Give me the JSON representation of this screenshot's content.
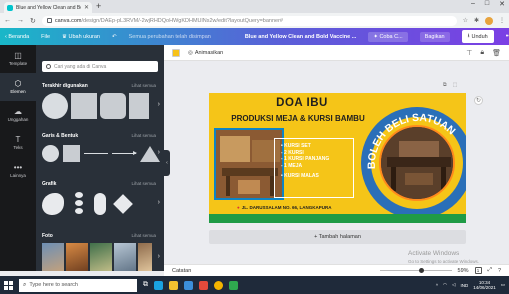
{
  "browser": {
    "tab_title": "Blue and Yellow Clean and Bo...",
    "url_host": "canva.com",
    "url_path": "/design/DAEp-pL3RVM/-2wjRHDQoHWgKDHMUlNs2w/edit?layoutQuery=banner#",
    "window_controls": [
      "–",
      "□",
      "✕"
    ]
  },
  "topbar": {
    "home": "‹ Beranda",
    "file": "File",
    "resize": "♛ Ubah ukuran",
    "undo": "↶",
    "saved_status": "Semua perubahan telah disimpan",
    "design_title": "Blue and Yellow Clean and Bold Vaccine ...",
    "try_pro": "✦ Coba C...",
    "share": "Bagikan",
    "download": "Unduh",
    "more": "•••"
  },
  "rail": [
    {
      "label": "Template",
      "icon": "◫"
    },
    {
      "label": "Elemen",
      "icon": "⬡"
    },
    {
      "label": "Unggahan",
      "icon": "☁"
    },
    {
      "label": "Teks",
      "icon": "T"
    },
    {
      "label": "Lainnya",
      "icon": "•••"
    }
  ],
  "panel": {
    "search_placeholder": "Cari yang ada di Canva",
    "sections": [
      {
        "title": "Terakhir digunakan",
        "more": "Lihat semua"
      },
      {
        "title": "Garis & Bentuk",
        "more": "Lihat semua"
      },
      {
        "title": "Grafik",
        "more": "Lihat semua"
      },
      {
        "title": "Foto",
        "more": "Lihat semua"
      }
    ]
  },
  "toolbar": {
    "animate": "Animasikan",
    "accent_color": "#f7c21a"
  },
  "design": {
    "title": "DOA IBU",
    "subtitle": "PRODUKSI MEJA & KURSI BAMBU",
    "items": [
      "• KURSI SET",
      "- 2 KURSI",
      "- 1 KURSI PANJANG",
      "- 1 MEJA"
    ],
    "extra_item": "• KURSI MALAS",
    "circle_text": "BOLEH BELI SATUAN",
    "address": "JL. DARUSSALAM NO. 66, LANGKAPURA",
    "bg_color": "#f5c518",
    "accent_blue": "#2a6fb8",
    "accent_green": "#1f9b46"
  },
  "canvas": {
    "add_page": "+ Tambah halaman",
    "notes": "Catatan",
    "zoom": "59%",
    "zoom_fraction": 0.59,
    "page_number": "1"
  },
  "watermark": {
    "line1": "Activate Windows",
    "line2": "Go to Settings to activate Windows."
  },
  "taskbar": {
    "search_placeholder": "Type here to search",
    "time": "10:34",
    "date": "14/06/2021",
    "lang": "IND"
  }
}
